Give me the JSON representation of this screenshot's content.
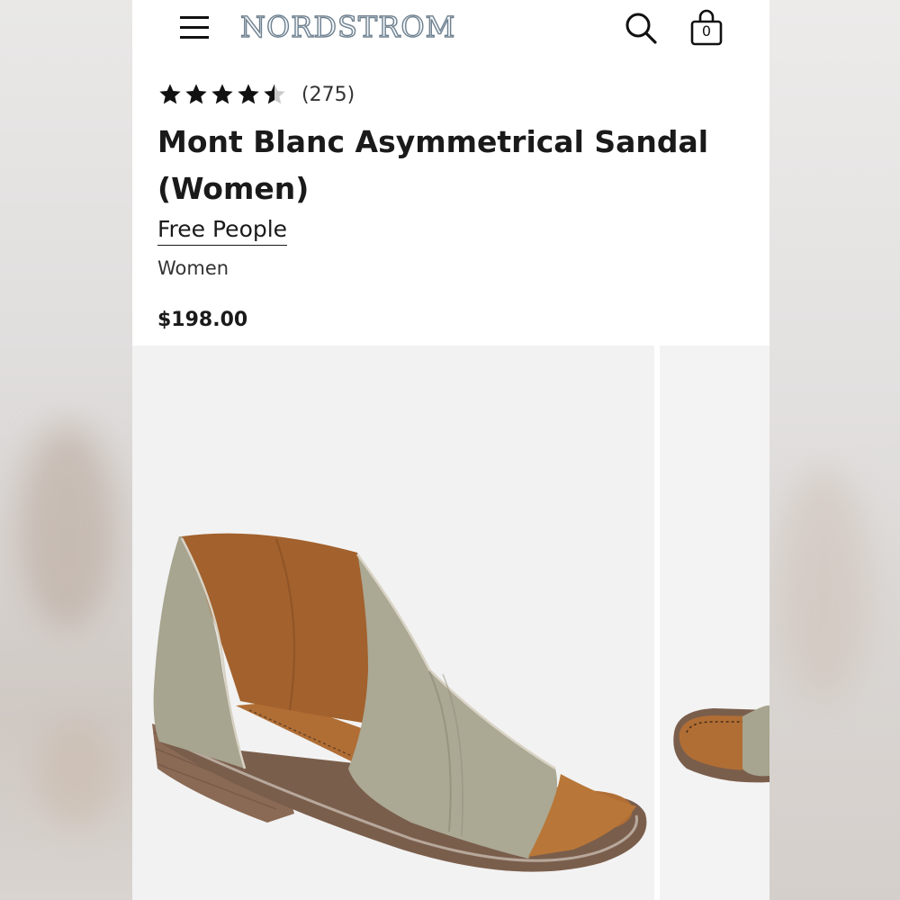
{
  "header": {
    "logo_text": "NORDSTROM",
    "menu_icon": "hamburger-menu-icon",
    "search_icon": "search-icon",
    "bag_icon": "shopping-bag-icon",
    "bag_count": "0"
  },
  "product": {
    "rating_value": 4.5,
    "rating_max": 5,
    "review_count": "(275)",
    "title": "Mont Blanc Asymmetrical Sandal (Women)",
    "brand": "Free People",
    "department": "Women",
    "price": "$198.00"
  },
  "gallery": {
    "images": [
      "sandal-side-view",
      "sandal-alternate-view"
    ]
  },
  "colors": {
    "accent": "#1a1a1a",
    "logo_outline": "#6f8190",
    "leather": "#a8a592",
    "lining": "#a9652e"
  }
}
